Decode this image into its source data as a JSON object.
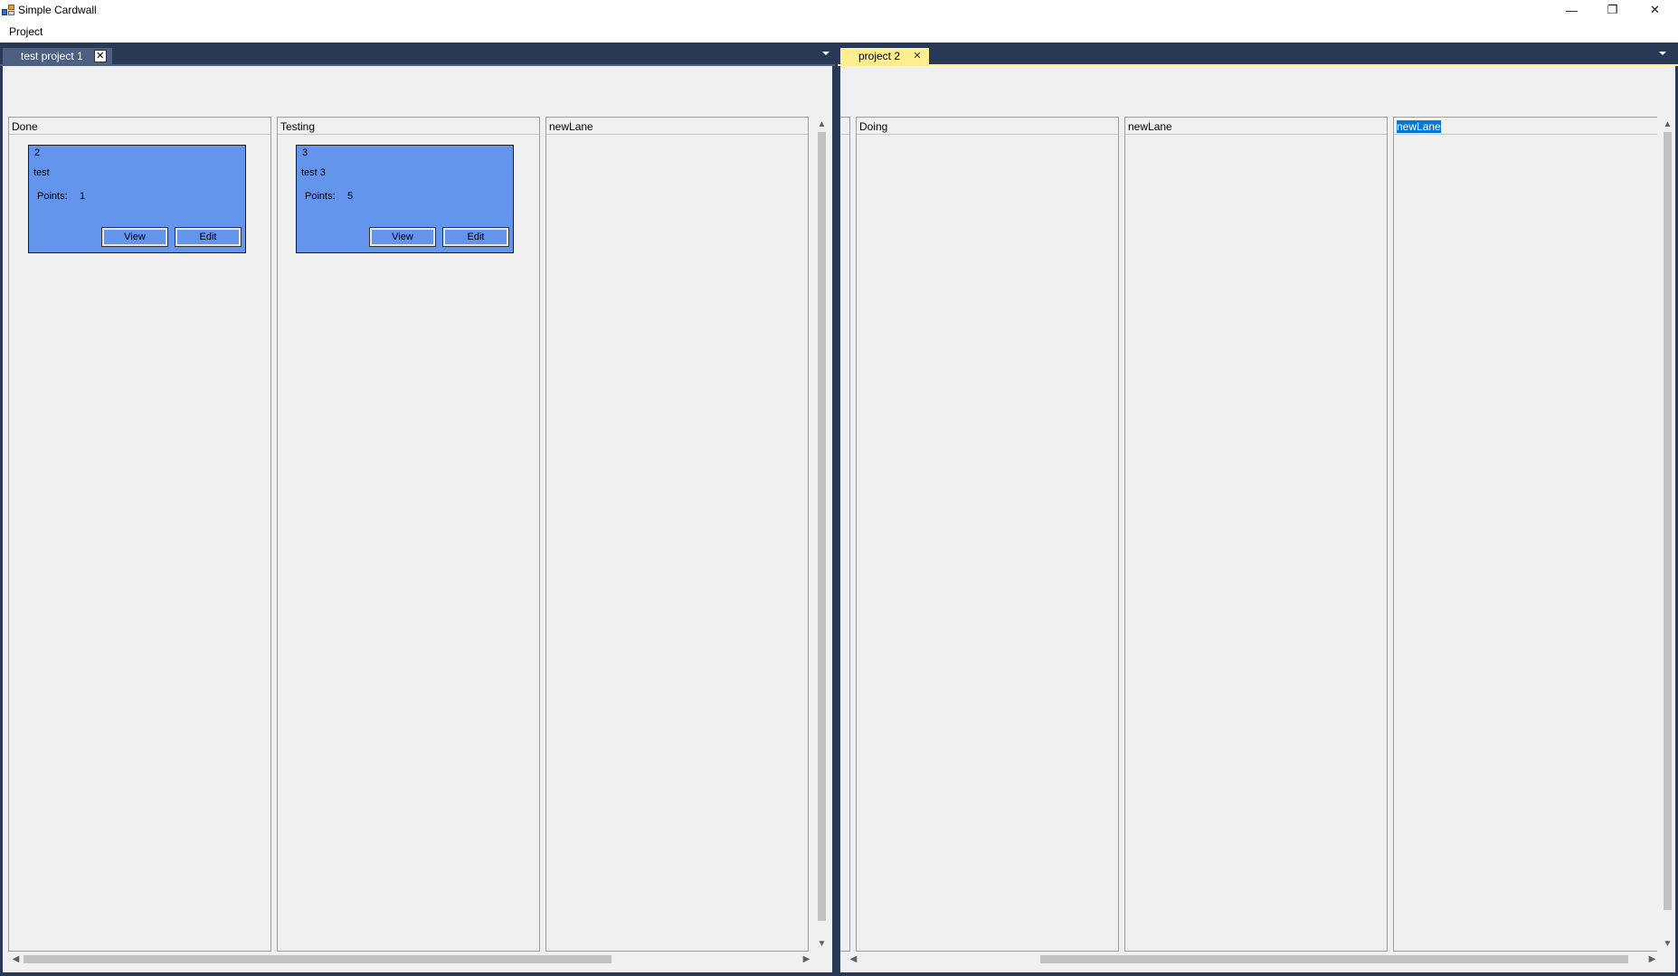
{
  "window": {
    "title": "Simple Cardwall",
    "minimize_glyph": "—",
    "restore_glyph": "❐",
    "close_glyph": "✕"
  },
  "menu": {
    "items": [
      {
        "label": "Project"
      }
    ]
  },
  "panes": [
    {
      "tab": {
        "label": "test project 1",
        "close_glyph": "✕",
        "active": false,
        "tab_color": "#4d6082",
        "text_color": "#ffffff"
      },
      "lanes": [
        {
          "name": "Done",
          "cards": [
            {
              "id": "2",
              "title": "test",
              "points_label": "Points:",
              "points": "1",
              "view_label": "View",
              "edit_label": "Edit"
            }
          ]
        },
        {
          "name": "Testing",
          "cards": [
            {
              "id": "3",
              "title": "test 3",
              "points_label": "Points:",
              "points": "5",
              "view_label": "View",
              "edit_label": "Edit"
            }
          ]
        },
        {
          "name": "newLane",
          "cards": []
        }
      ]
    },
    {
      "tab": {
        "label": "project 2",
        "close_glyph": "✕",
        "active": true,
        "tab_color": "#ffef91",
        "text_color": "#000000"
      },
      "lanes": [
        {
          "name": "Doing",
          "cards": []
        },
        {
          "name": "newLane",
          "cards": []
        },
        {
          "name": "newLane",
          "cards": [],
          "header_selected": true
        }
      ]
    }
  ],
  "colors": {
    "dock_background": "#293955",
    "card_background": "#6495ed",
    "active_tab": "#ffef91",
    "selection": "#0078d7"
  }
}
